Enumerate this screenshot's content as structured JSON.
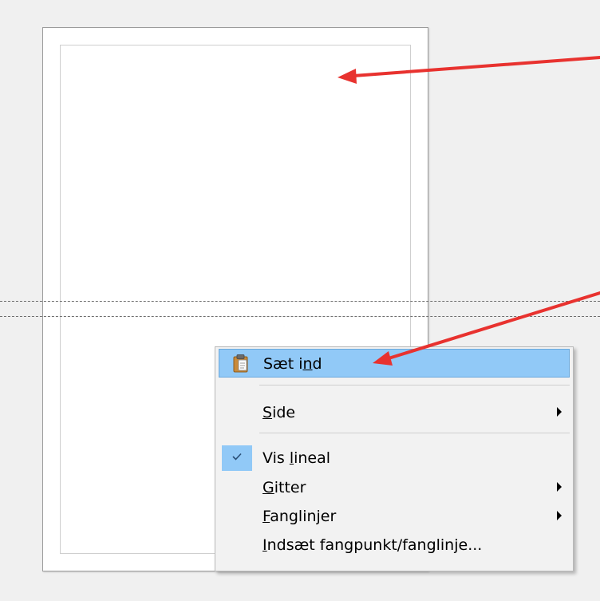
{
  "context_menu": {
    "items": {
      "paste": {
        "pre": "Sæt i",
        "accel": "n",
        "post": "d",
        "icon": "clipboard-paste-icon"
      },
      "side": {
        "pre": "",
        "accel": "S",
        "post": "ide",
        "submenu": true
      },
      "vis_lineal": {
        "pre": "Vis ",
        "accel": "l",
        "post": "ineal",
        "checked": true
      },
      "gitter": {
        "pre": "",
        "accel": "G",
        "post": "itter",
        "submenu": true
      },
      "fanglinjer": {
        "pre": "",
        "accel": "F",
        "post": "anglinjer",
        "submenu": true
      },
      "indsaet": {
        "pre": "",
        "accel": "I",
        "post": "ndsæt fangpunkt/fanglinje...",
        "submenu": false
      }
    }
  },
  "colors": {
    "highlight": "#91c9f7",
    "annotation_arrow": "#e8322f",
    "background": "#f0f0f0"
  }
}
